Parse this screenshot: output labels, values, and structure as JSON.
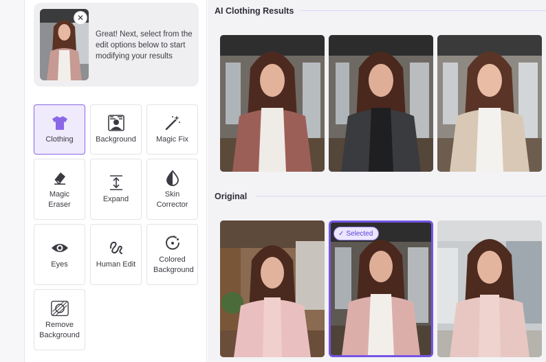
{
  "hint": {
    "message": "Great! Next, select from the edit options below to start modifying your results",
    "close_icon": "close-icon"
  },
  "tools": [
    {
      "id": "clothing",
      "label": "Clothing",
      "icon": "shirt-icon",
      "active": true
    },
    {
      "id": "background",
      "label": "Background",
      "icon": "background-person-icon",
      "active": false
    },
    {
      "id": "magic-fix",
      "label": "Magic Fix",
      "icon": "magic-wand-icon",
      "active": false
    },
    {
      "id": "magic-eraser",
      "label": "Magic Eraser",
      "icon": "eraser-icon",
      "active": false
    },
    {
      "id": "expand",
      "label": "Expand",
      "icon": "expand-vertical-icon",
      "active": false
    },
    {
      "id": "skin-corrector",
      "label": "Skin Corrector",
      "icon": "contrast-drop-icon",
      "active": false
    },
    {
      "id": "eyes",
      "label": "Eyes",
      "icon": "eye-icon",
      "active": false
    },
    {
      "id": "human-edit",
      "label": "Human Edit",
      "icon": "scribble-icon",
      "active": false
    },
    {
      "id": "colored-background",
      "label": "Colored Background",
      "icon": "color-circle-icon",
      "active": false
    },
    {
      "id": "remove-background",
      "label": "Remove Background",
      "icon": "remove-background-icon",
      "active": false
    }
  ],
  "sections": {
    "ai_results_title": "AI Clothing Results",
    "original_title": "Original"
  },
  "selected_badge": "Selected",
  "colors": {
    "accent": "#7454e6",
    "active_tool_bg": "#efeafc"
  }
}
